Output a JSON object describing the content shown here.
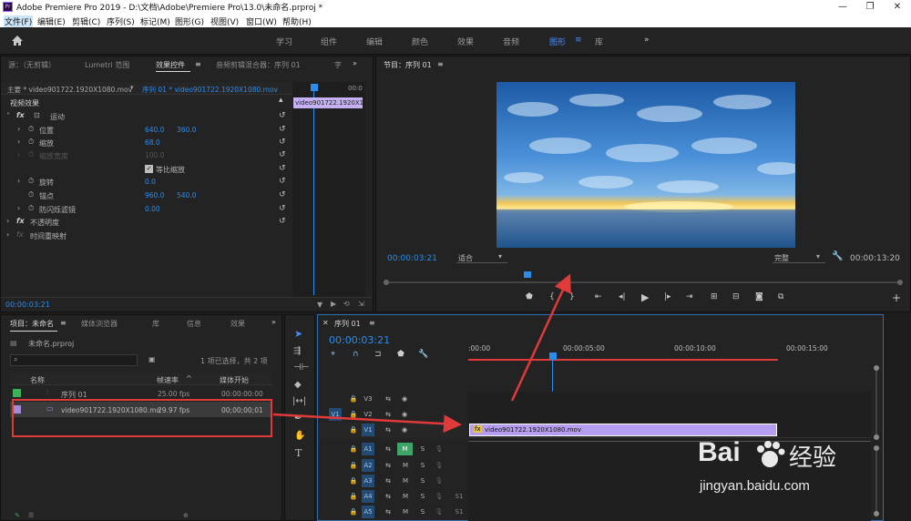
{
  "title_bar": {
    "title": "Adobe Premiere Pro 2019 - D:\\文档\\Adobe\\Premiere Pro\\13.0\\未命名.prproj *",
    "minimize": "—",
    "restore": "❐",
    "close": "✕"
  },
  "menu": [
    "文件(F)",
    "编辑(E)",
    "剪辑(C)",
    "序列(S)",
    "标记(M)",
    "图形(G)",
    "视图(V)",
    "窗口(W)",
    "帮助(H)"
  ],
  "workspaces": [
    "学习",
    "组件",
    "编辑",
    "颜色",
    "效果",
    "音频",
    "图形",
    "库"
  ],
  "workspace_active": "图形",
  "workspace_more": "»",
  "source_panel": {
    "tabs": [
      "源：（无剪辑）",
      "Lumetri 范围",
      "效果控件",
      "音频剪辑混合器：序列 01",
      "字"
    ],
    "more": "»",
    "master_label": "主要 * video901722.1920X1080.mov",
    "seq_label": "序列 01 * video901722.1920X1080.mov",
    "ruler_start": "",
    "ruler_end": "00:0",
    "clip_label": "video901722.1920X1",
    "section_video": "视频效果",
    "motion_label": "运动",
    "properties": [
      {
        "name": "位置",
        "v1": "640.0",
        "v2": "360.0"
      },
      {
        "name": "缩放",
        "v1": "68.0",
        "v2": ""
      },
      {
        "name": "缩放宽度",
        "v1": "100.0",
        "v2": ""
      },
      {
        "name": "等比缩放",
        "v1": "",
        "v2": ""
      },
      {
        "name": "旋转",
        "v1": "0.0",
        "v2": ""
      },
      {
        "name": "锚点",
        "v1": "960.0",
        "v2": "540.0"
      },
      {
        "name": "防闪烁滤镜",
        "v1": "0.00",
        "v2": ""
      }
    ],
    "opacity_label": "不透明度",
    "time_remap_label": "时间重映射",
    "timecode": "00:00:03:21"
  },
  "program": {
    "tab": "节目：序列 01",
    "timecode_left": "00:00:03:21",
    "fit": "适合",
    "quality": "完整",
    "timecode_right": "00:00:13:20"
  },
  "project": {
    "tabs": [
      "项目：未命名",
      "媒体浏览器",
      "库",
      "信息",
      "效果"
    ],
    "file": "未命名.prproj",
    "selection_info": "1 项已选择，共 2 项",
    "columns": [
      "名称",
      "帧速率",
      "媒体开始"
    ],
    "items": [
      {
        "name": "序列 01",
        "fps": "25.00 fps",
        "start": "00:00:00:00",
        "color": "#3cb15a"
      },
      {
        "name": "video901722.1920X1080.mo",
        "fps": "29.97 fps",
        "start": "00;00;00;01",
        "color": "#a389d9"
      }
    ],
    "more": "»"
  },
  "timeline": {
    "tab": "序列 01",
    "timecode": "00:00:03:21",
    "ruler": [
      ":00:00",
      "00:00:05:00",
      "00:00:10:00",
      "00:00:15:00"
    ],
    "video_tracks": [
      "V3",
      "V2",
      "V1"
    ],
    "audio_tracks": [
      "A1",
      "A2",
      "A3",
      "A4",
      "A5"
    ],
    "src_v": "V1",
    "src_a": "A1",
    "clip_label": "video901722.1920X1080.mov",
    "m": "M",
    "s": "S"
  },
  "watermark": {
    "brand": "Bai",
    "brand_cn": "经验",
    "url": "jingyan.baidu.com"
  },
  "colors": {
    "accent_blue": "#2d8ceb",
    "clip_purple": "#a389d9",
    "annotation_red": "#e03a3a"
  }
}
